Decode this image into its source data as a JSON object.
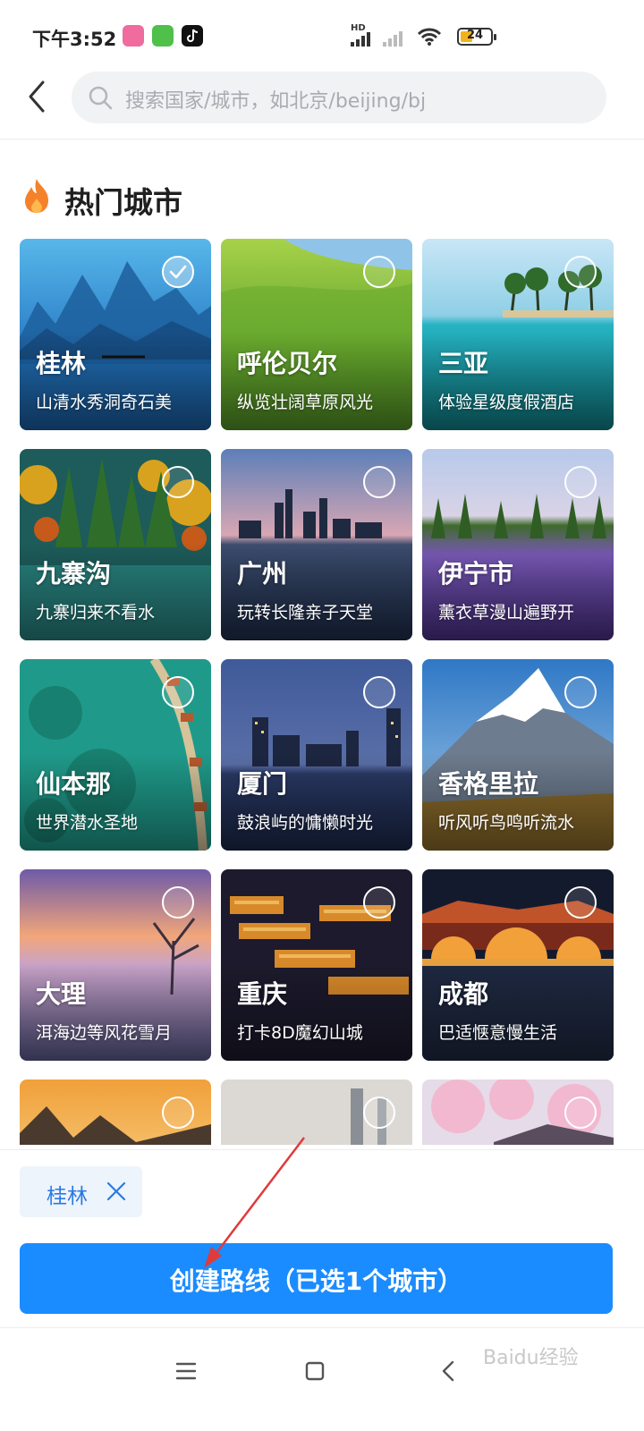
{
  "status_bar": {
    "time": "下午3:52",
    "battery": "24",
    "network_label": "HD"
  },
  "header": {
    "search_placeholder": "搜索国家/城市，如北京/beijing/bj"
  },
  "section": {
    "title": "热门城市"
  },
  "cities": [
    {
      "name": "桂林",
      "desc": "山清水秀洞奇石美",
      "selected": true
    },
    {
      "name": "呼伦贝尔",
      "desc": "纵览壮阔草原风光",
      "selected": false
    },
    {
      "name": "三亚",
      "desc": "体验星级度假酒店",
      "selected": false
    },
    {
      "name": "九寨沟",
      "desc": "九寨归来不看水",
      "selected": false
    },
    {
      "name": "广州",
      "desc": "玩转长隆亲子天堂",
      "selected": false
    },
    {
      "name": "伊宁市",
      "desc": "薰衣草漫山遍野开",
      "selected": false
    },
    {
      "name": "仙本那",
      "desc": "世界潜水圣地",
      "selected": false
    },
    {
      "name": "厦门",
      "desc": "鼓浪屿的慵懒时光",
      "selected": false
    },
    {
      "name": "香格里拉",
      "desc": "听风听鸟鸣听流水",
      "selected": false
    },
    {
      "name": "大理",
      "desc": "洱海边等风花雪月",
      "selected": false
    },
    {
      "name": "重庆",
      "desc": "打卡8D魔幻山城",
      "selected": false
    },
    {
      "name": "成都",
      "desc": "巴适惬意慢生活",
      "selected": false
    }
  ],
  "selected_chip": {
    "label": "桂林"
  },
  "create_button": {
    "label": "创建路线（已选1个城市）"
  },
  "watermark": "Baidu经验",
  "colors": {
    "accent": "#1a8cff",
    "chip_bg": "#eef4fb",
    "chip_text": "#2a7ae2",
    "flame": "#f5822a",
    "annotation_arrow": "#e03a3a"
  },
  "icons": [
    "back-arrow-icon",
    "search-icon",
    "flame-icon",
    "checkmark-icon",
    "close-icon",
    "menu-icon",
    "home-square-icon",
    "nav-back-icon"
  ]
}
